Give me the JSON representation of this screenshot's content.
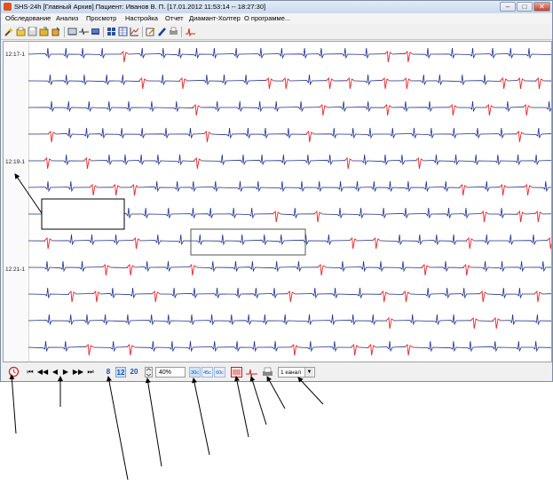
{
  "window": {
    "title": "SHS-24h [Главный Архив] Пациент: Иванов В. П. [17.01.2012 11:53:14 -- 18:27:30]",
    "buttons": {
      "minimize": "–",
      "maximize": "□",
      "close": "✕"
    }
  },
  "menu": [
    {
      "label": "Обследование"
    },
    {
      "label": "Анализ"
    },
    {
      "label": "Просмотр"
    },
    {
      "label": "Настройка"
    },
    {
      "label": "Отчет"
    },
    {
      "label": "Диамант-Холтер"
    },
    {
      "label": "О программе..."
    }
  ],
  "toolbar": {
    "icons": [
      "wand-icon",
      "open-archive-icon",
      "save-icon",
      "export-icon",
      "delete-icon",
      "list-view-icon",
      "ecg-view-icon",
      "grid-view-icon",
      "layout-icon",
      "table-icon",
      "chart-icon",
      "edit-icon",
      "pen-icon",
      "print-icon",
      "ecg-marker-icon"
    ]
  },
  "ecg": {
    "time_labels": [
      "12:17-1",
      "12:19-1",
      "12:21-1"
    ],
    "strip_count": 12,
    "colors": {
      "normal": "#1f2f8f",
      "highlight": "#e8262b",
      "artifact": "#a8a8a8"
    }
  },
  "bottom": {
    "nav": {
      "first": "⏮",
      "prev_page": "◀◀",
      "prev": "◀",
      "next": "▶",
      "next_page": "▶▶",
      "last": "⏭"
    },
    "speeds": [
      "8",
      "12",
      "20"
    ],
    "active_speed": "12",
    "scale_value": "40%",
    "scale_buttons": [
      "30c",
      "45c",
      "60c"
    ],
    "active_scale": "30c",
    "channel_select": "1 канал"
  }
}
